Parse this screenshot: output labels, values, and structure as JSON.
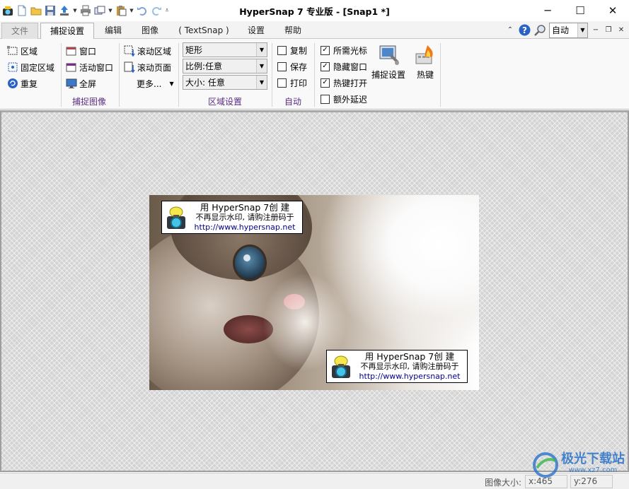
{
  "window": {
    "title": "HyperSnap 7 专业版 - [Snap1 *]",
    "controls": {
      "minimize": "─",
      "maximize": "☐",
      "close": "✕"
    }
  },
  "quick_access": {
    "icons": [
      "app-icon",
      "new-file-icon",
      "open-folder-icon",
      "save-icon",
      "upload-icon",
      "print-icon",
      "copy-window-icon",
      "paste-icon",
      "undo-icon",
      "redo-icon",
      "customize-icon"
    ],
    "dropdown_glyph": "▼"
  },
  "menu_tabs": [
    {
      "label": "文件",
      "id": "file"
    },
    {
      "label": "捕捉设置",
      "id": "capture-settings"
    },
    {
      "label": "编辑",
      "id": "edit"
    },
    {
      "label": "图像",
      "id": "image"
    },
    {
      "label": "( TextSnap )",
      "id": "textsnap"
    },
    {
      "label": "设置",
      "id": "settings"
    },
    {
      "label": "帮助",
      "id": "help"
    }
  ],
  "right_tools": {
    "collapse": "⌃",
    "zoom_value": "自动",
    "mdi_min": "−",
    "mdi_restore": "❐",
    "mdi_close": "✕"
  },
  "ribbon": {
    "capture_image": {
      "label": "捕捉图像",
      "col1": [
        "区域",
        "固定区域",
        "重复"
      ],
      "col2": [
        "窗口",
        "活动窗口",
        "全屏"
      ],
      "col3": [
        "滚动区域",
        "滚动页面",
        "更多..."
      ]
    },
    "region_settings": {
      "label": "区域设置",
      "shape": "矩形",
      "ratio": "比例:任意",
      "size": "大小: 任意"
    },
    "auto": {
      "label": "自动",
      "items": [
        {
          "label": "复制",
          "checked": false
        },
        {
          "label": "保存",
          "checked": false
        },
        {
          "label": "打印",
          "checked": false
        }
      ]
    },
    "options": {
      "items": [
        {
          "label": "所需光标",
          "checked": true
        },
        {
          "label": "隐藏窗口",
          "checked": true
        },
        {
          "label": "热键打开",
          "checked": true
        },
        {
          "label": "额外延迟",
          "checked": false
        }
      ]
    },
    "big_buttons": {
      "capture_settings": "捕捉设置",
      "hotkeys": "热键"
    }
  },
  "watermark": {
    "line1": "用 HyperSnap 7创 建",
    "line2": "不再显示水印, 请购注册码于",
    "line3": "http://www.hypersnap.net"
  },
  "statusbar": {
    "image_size_label": "图像大小:",
    "x": "x:465",
    "y": "y:276"
  },
  "site_logo": {
    "text": "极光下载站",
    "url": "www.xz7.com"
  }
}
